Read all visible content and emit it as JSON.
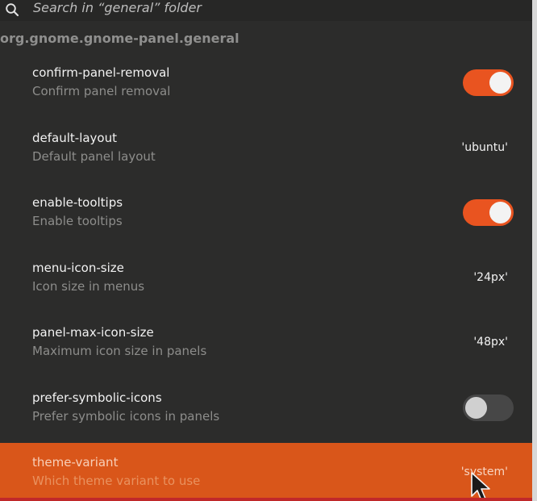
{
  "search": {
    "placeholder": "Search in “general” folder"
  },
  "schema": {
    "title": "org.gnome.gnome-panel.general"
  },
  "keys": [
    {
      "name": "confirm-panel-removal",
      "summary": "Confirm panel removal",
      "type": "toggle",
      "enabled": true
    },
    {
      "name": "default-layout",
      "summary": "Default panel layout",
      "type": "value",
      "value": "'ubuntu'"
    },
    {
      "name": "enable-tooltips",
      "summary": "Enable tooltips",
      "type": "toggle",
      "enabled": true
    },
    {
      "name": "menu-icon-size",
      "summary": "Icon size in menus",
      "type": "value",
      "value": "'24px'"
    },
    {
      "name": "panel-max-icon-size",
      "summary": "Maximum icon size in panels",
      "type": "value",
      "value": "'48px'"
    },
    {
      "name": "prefer-symbolic-icons",
      "summary": "Prefer symbolic icons in panels",
      "type": "toggle",
      "enabled": false
    },
    {
      "name": "theme-variant",
      "summary": "Which theme variant to use",
      "type": "value",
      "value": "'system'",
      "selected": true
    }
  ],
  "colors": {
    "accent": "#e95420",
    "background": "#2c2c2b",
    "selected_row": "#d9561a"
  }
}
